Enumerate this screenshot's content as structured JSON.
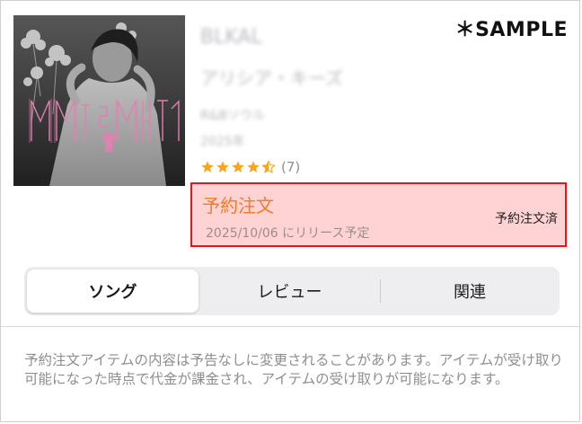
{
  "sample_label": "＊SAMPLE",
  "album": {
    "title": "BLKAL",
    "artist": "アリシア・キーズ",
    "genre": "R&Bソウル",
    "year": "2025年",
    "rating": 4.5,
    "rating_count": "(7)",
    "star_color": "#f5a623"
  },
  "preorder": {
    "title": "予約注文",
    "release": "2025/10/06 にリリース予定",
    "status": "予約注文済",
    "highlight_border": "#e3161d",
    "highlight_fill": "#ffd3d3",
    "accent": "#f47a2a"
  },
  "tabs": [
    {
      "label": "ソング",
      "selected": true
    },
    {
      "label": "レビュー",
      "selected": false
    },
    {
      "label": "関連",
      "selected": false
    }
  ],
  "notice": "予約注文アイテムの内容は予告なしに変更されることがあります。アイテムが受け取り可能になった時点で代金が課金され、アイテムの受け取りが可能になります。"
}
